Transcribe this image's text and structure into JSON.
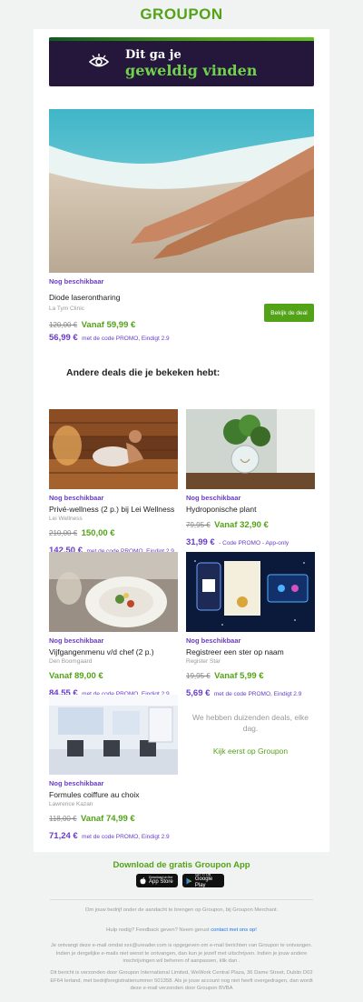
{
  "header": {
    "logo": "GROUPON"
  },
  "banner": {
    "line1": "Dit ga je",
    "line2": "geweldig vinden"
  },
  "hero": {
    "availability": "Nog beschikbaar",
    "title": "Diode laserontharing",
    "merchant": "La Tym Clinic",
    "old_price": "120,00 €",
    "new_price": "Vanaf 59,99 €",
    "promo_price": "56,99 €",
    "promo_text": "met de code PROMO, Eindigt 2.9",
    "button": "Bekijk de deal"
  },
  "section_heading": "Andere deals die je bekeken hebt:",
  "deals": [
    {
      "availability": "Nog beschikbaar",
      "title": "Privé-wellness (2 p.) bij Lei Wellness",
      "merchant": "Lei Wellness",
      "old_price": "210,00 €",
      "new_price": "150,00 €",
      "promo_price": "142,50 €",
      "promo_text": "met de code PROMO, Eindigt 2.9"
    },
    {
      "availability": "Nog beschikbaar",
      "title": "Hydroponische plant",
      "merchant": "",
      "old_price": "79,95 €",
      "new_price": "Vanaf 32,90 €",
      "promo_price": "31,99 €",
      "promo_text": "- Code PROMO - App-only"
    },
    {
      "availability": "Nog beschikbaar",
      "title": "Vijfgangenmenu v/d chef (2 p.)",
      "merchant": "Den Boomgaard",
      "old_price": "",
      "new_price": "Vanaf 89,00 €",
      "promo_price": "84,55 €",
      "promo_text": "met de code PROMO, Eindigt 2.9"
    },
    {
      "availability": "Nog beschikbaar",
      "title": "Registreer een ster op naam",
      "merchant": "Register Star",
      "old_price": "19,95 €",
      "new_price": "Vanaf 5,99 €",
      "promo_price": "5,69 €",
      "promo_text": "met de code PROMO, Eindigt 2.9"
    },
    {
      "availability": "Nog beschikbaar",
      "title": "Formules coiffure au choix",
      "merchant": "Lawrence Kazan",
      "old_price": "118,00 €",
      "new_price": "Vanaf 74,99 €",
      "promo_price": "71,24 €",
      "promo_text": "met de code PROMO, Eindigt 2.9"
    }
  ],
  "more": {
    "text": "We hebben duizenden deals, elke dag.",
    "link": "Kijk eerst op Groupon"
  },
  "app": {
    "title": "Download de gratis Groupon App",
    "appstore_small": "Download on the",
    "appstore_large": "App Store",
    "google_small": "GET IT ON",
    "google_large": "Google Play"
  },
  "footer": {
    "merchant_line": "Om jouw bedrijf onder de aandacht te brengen op Groupon, bij Groupon Merchant.",
    "help_line": "Hulp nodig? Feedback geven? Neem gerust",
    "help_link": "contact met ons op!",
    "reason": "Je ontvangt deze e-mail omdat xxx@ureader.com is opgegeven om e-mail berichten van Groupon te ontvangen. Indien je dergelijke e-mails niet wenst te ontvangen, dan kun je jezelf met uitschrijven. Indien je jouw andere inschrijvingen wil beheren of aanpassen, klik dan .",
    "address": "Dit bericht is verzonden door Groupon International Limited, WeWork Central Plaza, 36 Dame Street, Dublin D02 EF64 Ierland, met bedrijfsregistratienummer 501358. Als je jouw account nog niet heeft overgedragen, dan wordt deze e-mail verzonden door Groupon BVBA"
  },
  "colors": {
    "brand_green": "#53a318",
    "promo_purple": "#6a3cc9",
    "banner_bg": "#24173b"
  }
}
